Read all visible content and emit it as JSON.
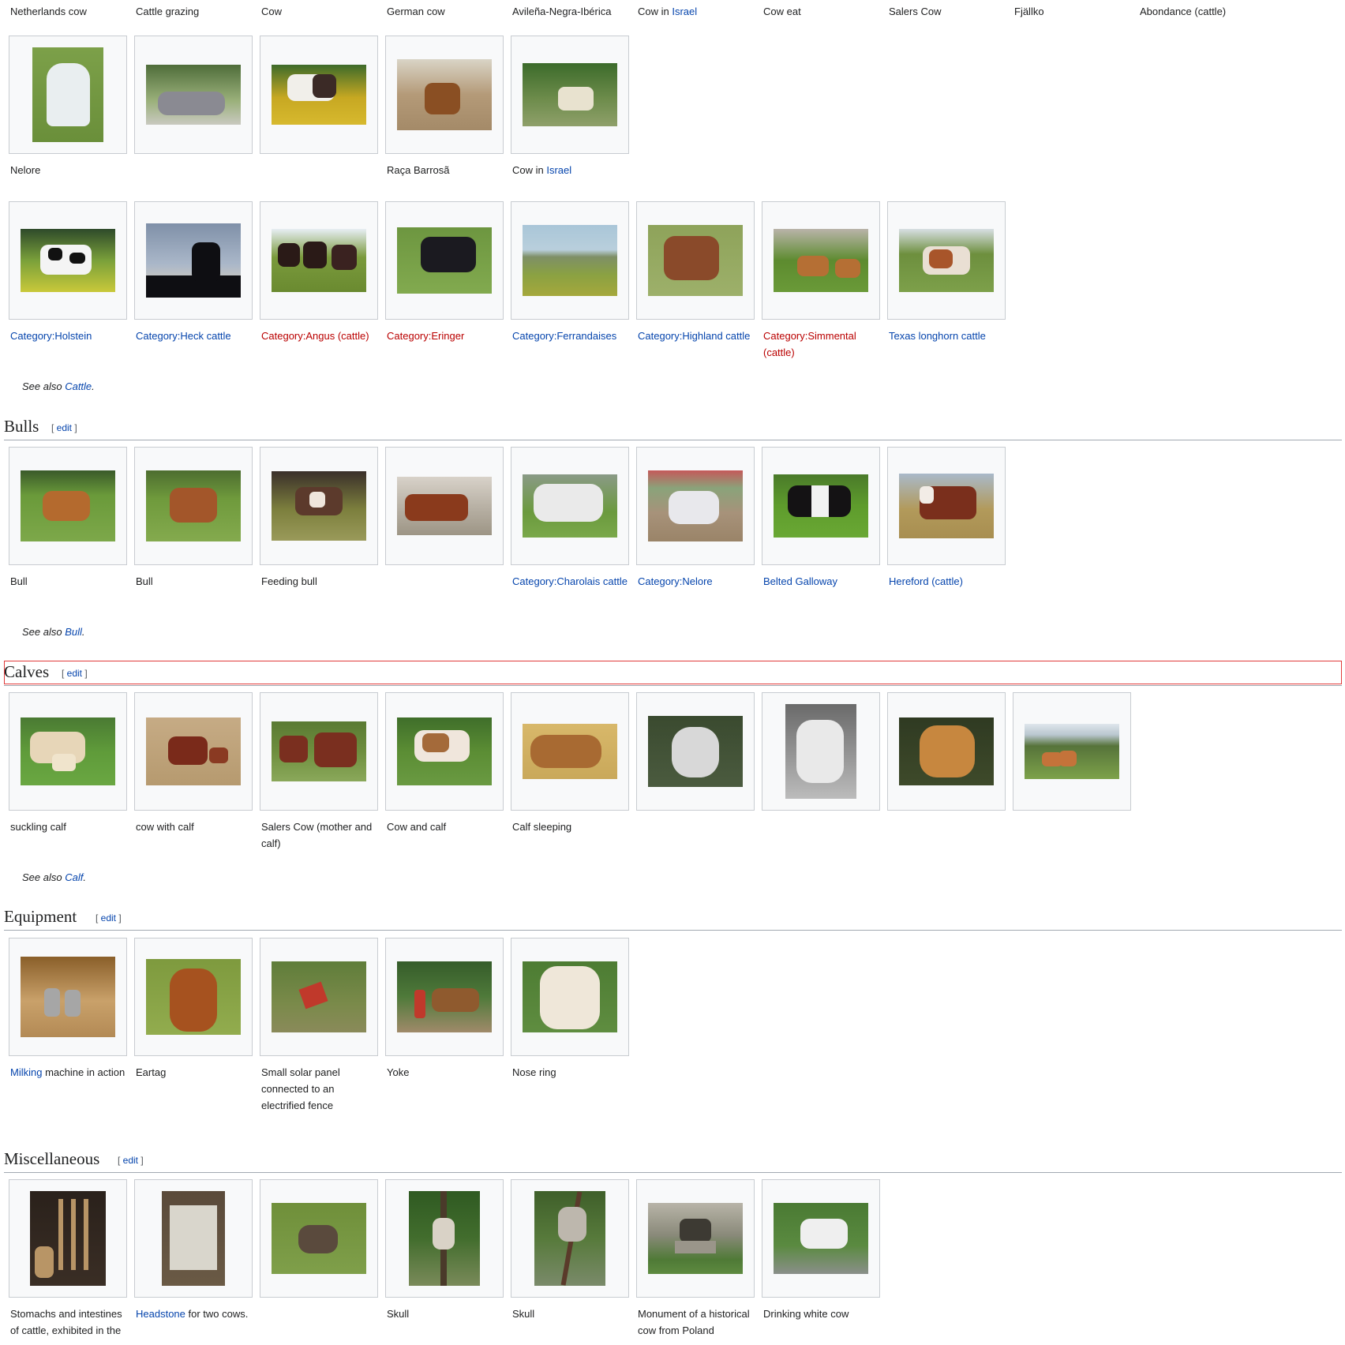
{
  "top_captions": [
    "Netherlands cow",
    "Cattle grazing",
    "Cow",
    "German cow",
    "Avileña-Negra-Ibérica",
    "Cow in ",
    "Cow eat",
    "Salers Cow",
    "Fjällko",
    "Abondance (cattle)"
  ],
  "top_captions_link": {
    "israel": "Israel"
  },
  "gallery1": {
    "items": [
      {
        "caption": "Nelore",
        "img": "white cow in field",
        "colors": [
          "#6a8f3a",
          "#e9eef0"
        ]
      },
      {
        "caption": "",
        "img": "cattle lying",
        "colors": [
          "#4f6d3a",
          "#8a8a92"
        ]
      },
      {
        "caption": "",
        "img": "spotted cow in flowers",
        "colors": [
          "#c7a822",
          "#3b2a26"
        ]
      },
      {
        "caption": "Raça Barrosã",
        "img": "brown cow in yard",
        "colors": [
          "#b49a78",
          "#8a4f23"
        ]
      },
      {
        "caption_prefix": "Cow in ",
        "caption_link": "Israel",
        "img": "white cow by trees",
        "colors": [
          "#3c6b2b",
          "#e8e2cf"
        ]
      }
    ]
  },
  "gallery2": {
    "items": [
      {
        "caption": "Category:Holstein",
        "type": "link",
        "colors": [
          "#7aa03a",
          "#111111"
        ]
      },
      {
        "caption": "Category:Heck cattle",
        "type": "link",
        "colors": [
          "#aab7c9",
          "#0e0e12"
        ]
      },
      {
        "caption": "Category:Angus (cattle)",
        "type": "redlink",
        "colors": [
          "#7a9a3c",
          "#2a1a17"
        ]
      },
      {
        "caption": "Category:Eringer",
        "type": "redlink",
        "colors": [
          "#6d9640",
          "#1b1a20"
        ]
      },
      {
        "caption": "Category:Ferrandaises",
        "type": "link",
        "colors": [
          "#8aa142",
          "#a9c6d8"
        ]
      },
      {
        "caption": "Category:Highland cattle",
        "type": "link",
        "colors": [
          "#8ea35a",
          "#8a4a2a"
        ]
      },
      {
        "caption": "Category:Simmental (cattle)",
        "type": "redlink",
        "colors": [
          "#5d8b2f",
          "#b56f34"
        ]
      },
      {
        "caption": "Texas longhorn cattle",
        "type": "link",
        "colors": [
          "#6d8f3e",
          "#a8552a"
        ]
      }
    ],
    "see_also_prefix": "See also ",
    "see_also_link": "Cattle",
    "see_also_suffix": "."
  },
  "bulls": {
    "title": "Bulls",
    "edit_open": "[ ",
    "edit_label": "edit",
    "edit_close": " ]",
    "items": [
      {
        "caption": "Bull",
        "type": "text",
        "colors": [
          "#6a9a3a",
          "#b46a2e"
        ]
      },
      {
        "caption": "Bull",
        "type": "text",
        "colors": [
          "#6f9a3c",
          "#a3562a"
        ]
      },
      {
        "caption": "Feeding bull",
        "type": "text",
        "colors": [
          "#7c7f3d",
          "#5c3a2c"
        ]
      },
      {
        "caption": "",
        "type": "text",
        "colors": [
          "#b9b2a6",
          "#8a3a1c"
        ]
      },
      {
        "caption": "Category:Charolais cattle",
        "type": "link",
        "colors": [
          "#6b9a3e",
          "#eaeaea"
        ]
      },
      {
        "caption": "Category:Nelore",
        "type": "link",
        "colors": [
          "#a7927a",
          "#e8e8ec"
        ]
      },
      {
        "caption": "Belted Galloway",
        "type": "link",
        "colors": [
          "#5e9c2c",
          "#141214"
        ]
      },
      {
        "caption": "Hereford (cattle)",
        "type": "link",
        "colors": [
          "#b29a5b",
          "#7a2f1c"
        ]
      }
    ],
    "see_also_prefix": "See also ",
    "see_also_link": "Bull",
    "see_also_suffix": "."
  },
  "calves": {
    "title": "Calves",
    "edit_open": "[ ",
    "edit_label": "edit",
    "edit_close": " ]",
    "items": [
      {
        "caption": "suckling calf",
        "colors": [
          "#5f9b3a",
          "#e7d6b8"
        ]
      },
      {
        "caption": "cow with calf",
        "colors": [
          "#b69a6f",
          "#7a2a1a"
        ]
      },
      {
        "caption": "Salers Cow (mother and calf)",
        "colors": [
          "#6e8e3e",
          "#7a2f1f"
        ]
      },
      {
        "caption": "Cow and calf",
        "colors": [
          "#5b8d34",
          "#a46a3a"
        ]
      },
      {
        "caption": "Calf sleeping",
        "colors": [
          "#c9a85a",
          "#a86a32"
        ]
      },
      {
        "caption": "",
        "colors": [
          "#4b5b3f",
          "#d8d8d8"
        ]
      },
      {
        "caption": "",
        "colors": [
          "#9a9a9a",
          "#e9e9e9"
        ]
      },
      {
        "caption": "",
        "colors": [
          "#2f3a22",
          "#c7873f"
        ]
      },
      {
        "caption": "",
        "colors": [
          "#7da24a",
          "#c4733a"
        ]
      }
    ],
    "see_also_prefix": "See also ",
    "see_also_link": "Calf",
    "see_also_suffix": "."
  },
  "equipment": {
    "title": "Equipment",
    "edit_open": "[ ",
    "edit_label": "edit",
    "edit_close": " ]",
    "items": [
      {
        "caption_link": "Milking",
        "caption": " machine in action",
        "colors": [
          "#8a5f2a",
          "#a6a6a6"
        ]
      },
      {
        "caption": "Eartag",
        "colors": [
          "#7e9a3e",
          "#a6521f"
        ]
      },
      {
        "caption": "Small solar panel connected to an electrified fence",
        "colors": [
          "#5f7d3a",
          "#c0392b"
        ]
      },
      {
        "caption": "Yoke",
        "colors": [
          "#355c2a",
          "#8f5a2e"
        ]
      },
      {
        "caption": "Nose ring",
        "colors": [
          "#4d7c33",
          "#efe7d9"
        ]
      }
    ]
  },
  "misc": {
    "title": "Miscellaneous",
    "edit_open": "[ ",
    "edit_label": "edit",
    "edit_close": " ]",
    "items": [
      {
        "caption": "Stomachs and intestines of cattle, exhibited in the",
        "colors": [
          "#2a211b",
          "#b89566"
        ]
      },
      {
        "caption_link": "Headstone",
        "caption": " for two cows.",
        "colors": [
          "#5a4a3a",
          "#d9d6cc"
        ]
      },
      {
        "caption": "",
        "colors": [
          "#6f8f3a",
          "#5a4a3d"
        ]
      },
      {
        "caption": "Skull",
        "colors": [
          "#426d2d",
          "#d9d2c6"
        ]
      },
      {
        "caption": "Skull",
        "colors": [
          "#577a3b",
          "#bdb7ad"
        ]
      },
      {
        "caption": "Monument of a historical cow from Poland",
        "colors": [
          "#8a8a7a",
          "#3d3a33"
        ]
      },
      {
        "caption": "Drinking white cow",
        "colors": [
          "#4a7a33",
          "#efefef"
        ]
      }
    ]
  }
}
